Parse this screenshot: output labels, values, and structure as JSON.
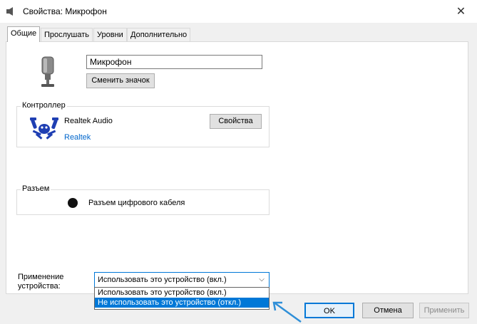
{
  "window": {
    "title": "Свойства: Микрофон",
    "close_glyph": "✕"
  },
  "tabs": [
    {
      "label": "Общие",
      "active": true
    },
    {
      "label": "Прослушать",
      "active": false
    },
    {
      "label": "Уровни",
      "active": false
    },
    {
      "label": "Дополнительно",
      "active": false
    }
  ],
  "general": {
    "device_icon": "microphone-icon",
    "name_value": "Микрофон",
    "change_icon_label": "Сменить значок"
  },
  "controller": {
    "group_label": "Контроллер",
    "logo": "realtek-crab-logo",
    "name": "Realtek Audio",
    "vendor_link": "Realtek",
    "properties_label": "Свойства"
  },
  "jack": {
    "group_label": "Разъем",
    "jack_color": "#111111",
    "jack_text": "Разъем цифрового кабеля"
  },
  "usage": {
    "label": "Применение устройства:",
    "selected": "Использовать это устройство (вкл.)",
    "options": [
      {
        "label": "Использовать это устройство (вкл.)",
        "highlighted": false
      },
      {
        "label": "Не использовать это устройство (откл.)",
        "highlighted": true
      }
    ]
  },
  "buttons": {
    "ok": "OK",
    "cancel": "Отмена",
    "apply": "Применить"
  },
  "colors": {
    "accent": "#0078d7",
    "link": "#0066cc",
    "annotation_arrow": "#2f8fd8"
  }
}
